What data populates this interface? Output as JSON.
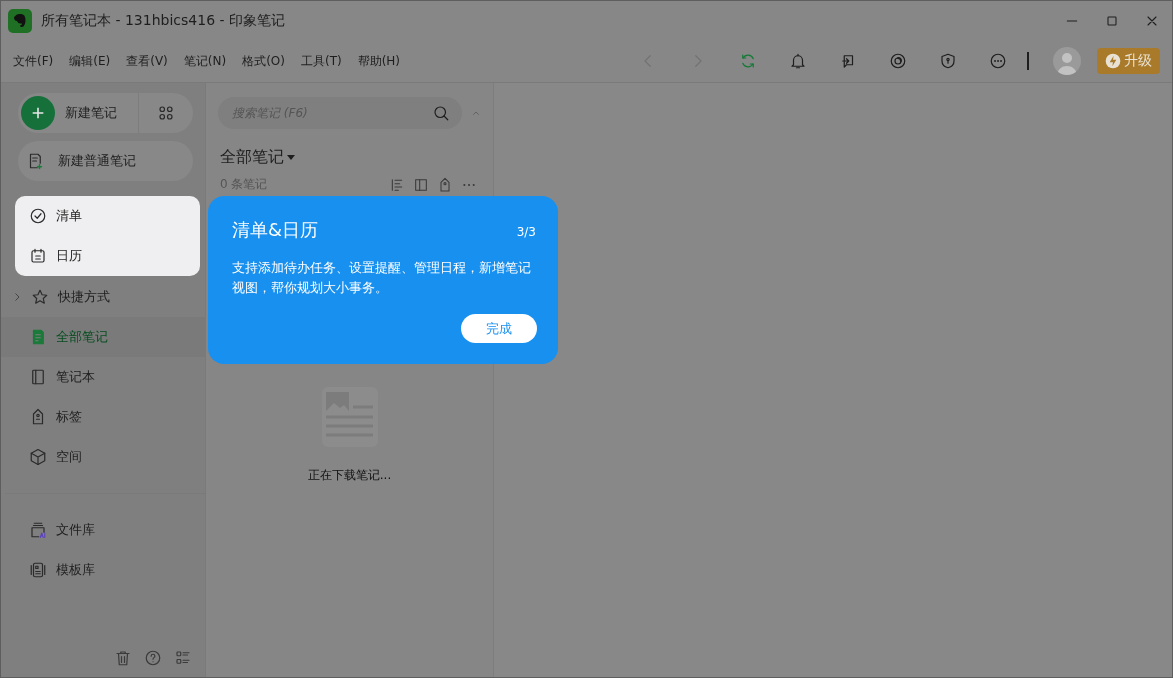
{
  "window": {
    "title": "所有笔记本 - 131hbics416 - 印象笔记"
  },
  "menus": [
    "文件(F)",
    "编辑(E)",
    "查看(V)",
    "笔记(N)",
    "格式(O)",
    "工具(T)",
    "帮助(H)"
  ],
  "upgrade": {
    "label": "升级"
  },
  "sidebar": {
    "new_note": "新建笔记",
    "new_plain_note": "新建普通笔记",
    "highlighted": [
      {
        "label": "清单"
      },
      {
        "label": "日历"
      }
    ],
    "shortcuts": {
      "label": "快捷方式",
      "expanded": false
    },
    "nav": [
      {
        "label": "全部笔记",
        "selected": true
      },
      {
        "label": "笔记本",
        "selected": false
      },
      {
        "label": "标签",
        "selected": false
      },
      {
        "label": "空间",
        "selected": false
      }
    ],
    "library": [
      "文件库",
      "模板库"
    ]
  },
  "note_list": {
    "search": {
      "placeholder": "搜索笔记 (F6)"
    },
    "heading": "全部笔记",
    "count": "0 条笔记",
    "status": "正在下载笔记..."
  },
  "guide": {
    "title": "清单&日历",
    "step": "3/3",
    "text": "支持添加待办任务、设置提醒、管理日程，新增笔记视图，帮你规划大小事务。",
    "button": "完成"
  }
}
